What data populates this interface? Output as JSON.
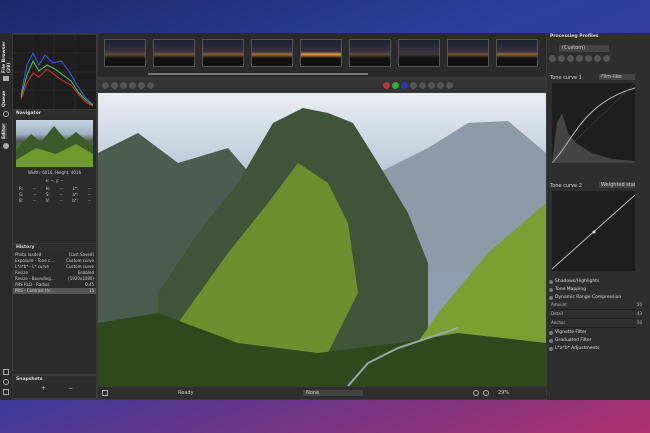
{
  "left_tabs": {
    "file_browser": "File Browser (28)",
    "queue": "Queue",
    "editor": "Editor"
  },
  "navigator": {
    "title": "Navigator",
    "size": "Width: 6016, Height: 4016",
    "coord_line": "x: --, y: --",
    "readout": [
      [
        "R:",
        "--",
        "H:",
        "--",
        "L*:",
        "--"
      ],
      [
        "G:",
        "--",
        "S:",
        "--",
        "a*:",
        "--"
      ],
      [
        "B:",
        "--",
        "V:",
        "--",
        "b*:",
        "--"
      ]
    ]
  },
  "history": {
    "title": "History",
    "rows": [
      [
        "Photo loaded",
        "(Last Saved)"
      ],
      [
        "Exposure - Tone c...",
        "Custom curve"
      ],
      [
        "L*a*b* - L* curve",
        "Custom curve"
      ],
      [
        "Resize",
        "Enabled"
      ],
      [
        "Resize - Bounding...",
        "(1920x1080)"
      ],
      [
        "PRS RLD - Radius",
        "0.45"
      ],
      [
        "PRS - Contrast thr...",
        "15"
      ]
    ]
  },
  "snapshots": {
    "title": "Snapshots",
    "add": "+",
    "remove": "−"
  },
  "filmstrip": {
    "count": 9
  },
  "status": {
    "ready": "Ready",
    "none": "None",
    "zoom": "29%"
  },
  "profiles": {
    "title": "Processing Profiles",
    "selected": "(Custom)"
  },
  "curves": {
    "tc1": "Tone curve 1",
    "tc1_mode": "Film-like",
    "tc2": "Tone curve 2",
    "tc2_mode": "Weighted standard"
  },
  "sections": {
    "shadows": "Shadows/Highlights",
    "tone_mapping": "Tone Mapping",
    "drc": "Dynamic Range Compression",
    "vignette": "Vignette Filter",
    "graduated": "Graduated Filter",
    "lab": "L*a*b* Adjustments"
  },
  "sliders": [
    {
      "label": "Amount",
      "value": "50"
    },
    {
      "label": "Detail",
      "value": "43"
    },
    {
      "label": "Anchor",
      "value": "50"
    }
  ],
  "colors": {
    "bg": "#3a3a3a",
    "panel": "#2b2b2b",
    "accent": "#6d6d6d"
  }
}
